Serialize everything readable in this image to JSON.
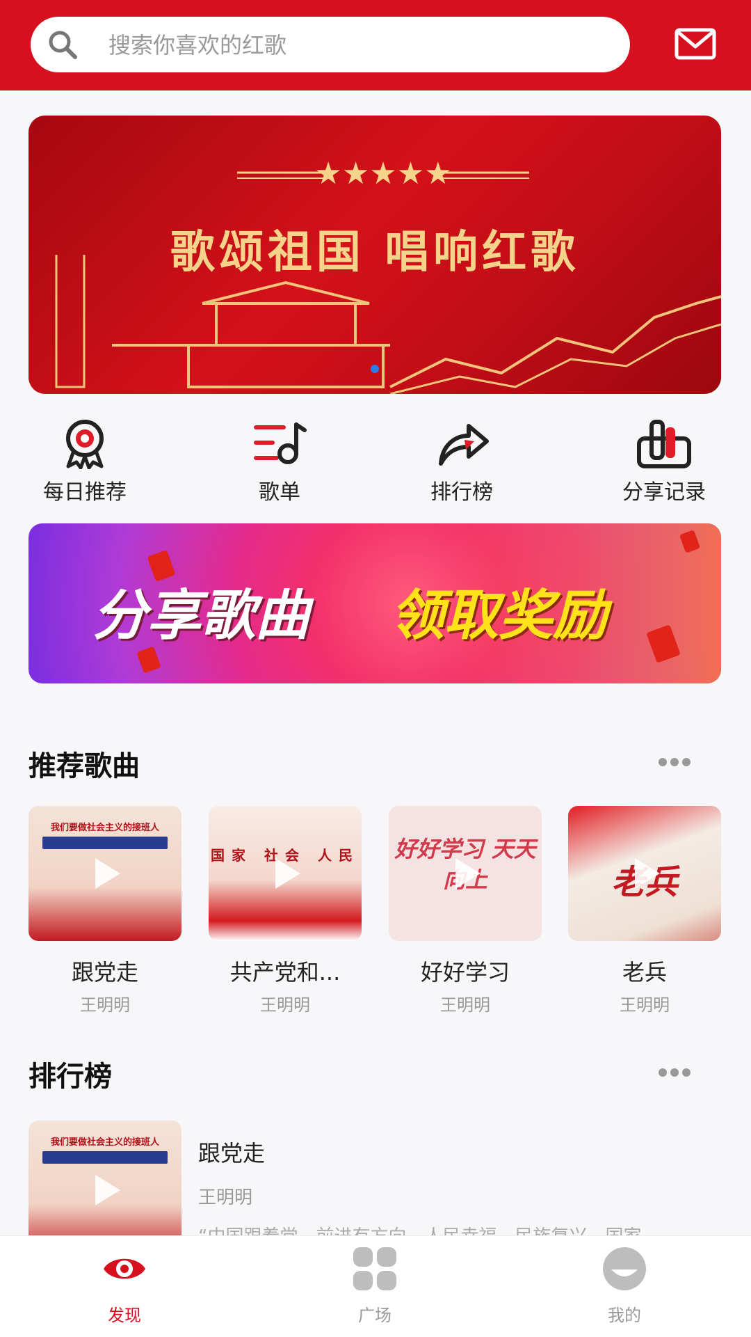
{
  "header": {
    "search_placeholder": "搜索你喜欢的红歌"
  },
  "hero_banner": {
    "title": "歌颂祖国   唱响红歌",
    "slide_count": 1,
    "active_slide": 1
  },
  "quick_menu": [
    {
      "label": "每日推荐",
      "icon": "award-ribbon-icon"
    },
    {
      "label": "歌单",
      "icon": "playlist-note-icon"
    },
    {
      "label": "排行榜",
      "icon": "share-arrow-icon"
    },
    {
      "label": "分享记录",
      "icon": "thumbs-up-icon"
    }
  ],
  "promo_banner": {
    "text_left": "分享歌曲",
    "text_right": "领取奖励"
  },
  "recommended": {
    "title": "推荐歌曲",
    "songs": [
      {
        "title": "跟党走",
        "artist": "王明明",
        "cover_text": "我们要做社会主义的接班人"
      },
      {
        "title": "共产党和...",
        "artist": "王明明",
        "cover_text": "国家 社会 人民"
      },
      {
        "title": "好好学习",
        "artist": "王明明",
        "cover_text": "好好学习 天天向上"
      },
      {
        "title": "老兵",
        "artist": "王明明",
        "cover_text": "老兵"
      }
    ]
  },
  "ranking": {
    "title": "排行榜",
    "items": [
      {
        "title": "跟党走",
        "artist": "王明明",
        "lyric": "“中国跟着党，前进有方向，人民幸福，民族复兴，国家"
      }
    ]
  },
  "tabbar": [
    {
      "label": "发现",
      "icon": "eye-icon",
      "active": true
    },
    {
      "label": "广场",
      "icon": "grid-icon",
      "active": false
    },
    {
      "label": "我的",
      "icon": "profile-icon",
      "active": false
    }
  ],
  "colors": {
    "brand_red": "#d7101f",
    "inactive_gray": "#bdbdbd",
    "promo_yellow": "#ffe21a"
  }
}
